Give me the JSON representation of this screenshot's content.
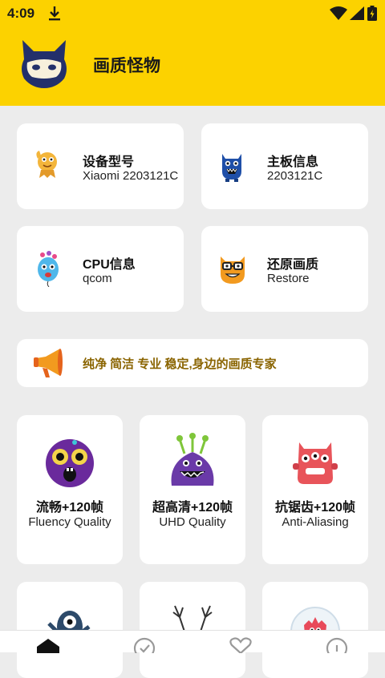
{
  "status": {
    "time": "4:09"
  },
  "header": {
    "title": "画质怪物"
  },
  "info_cards": [
    {
      "name": "设备型号",
      "value": "Xiaomi 2203121C"
    },
    {
      "name": "主板信息",
      "value": "2203121C"
    },
    {
      "name": "CPU信息",
      "value": "qcom"
    },
    {
      "name": "还原画质",
      "value": "Restore"
    }
  ],
  "slogan": "纯净 简洁 专业 稳定,身边的画质专家",
  "modes": [
    {
      "cn": "流畅+120帧",
      "en": "Fluency Quality"
    },
    {
      "cn": "超高清+120帧",
      "en": "UHD Quality"
    },
    {
      "cn": "抗锯齿+120帧",
      "en": "Anti-Aliasing"
    }
  ],
  "colors": {
    "accent": "#fcd200",
    "background": "#ececec",
    "slogan_text": "#8a6400"
  },
  "icons": {
    "bottom_nav": [
      "home-icon",
      "check-circle-icon",
      "heart-icon",
      "info-icon"
    ]
  }
}
